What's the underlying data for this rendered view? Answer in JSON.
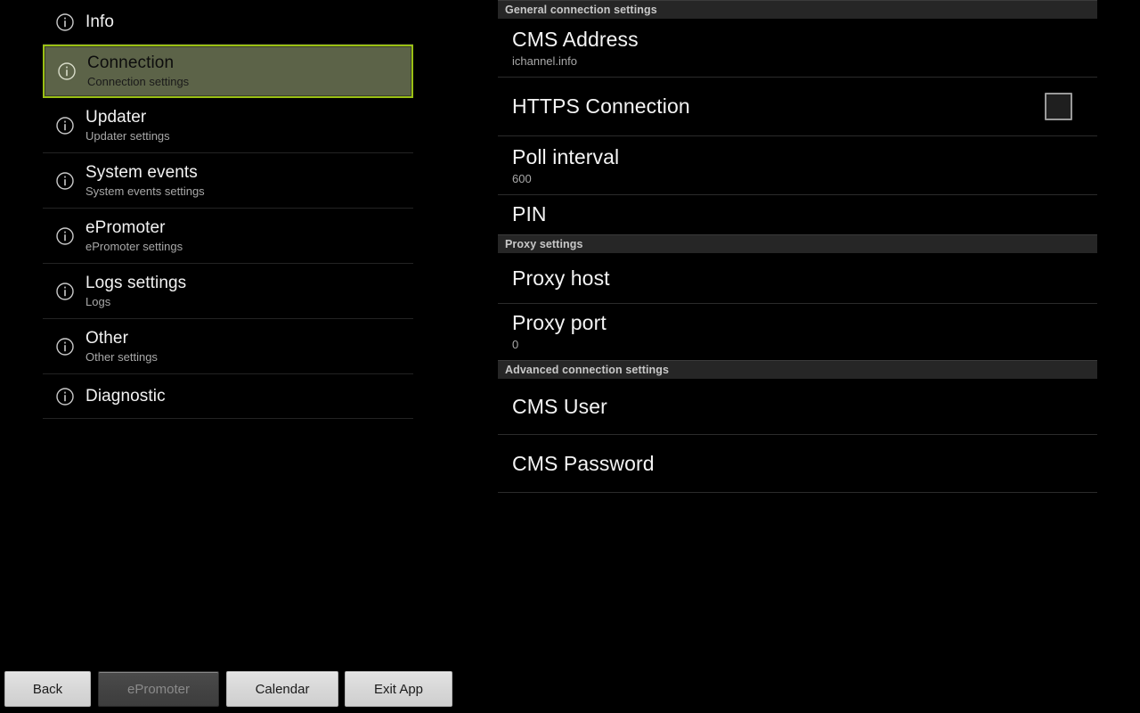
{
  "colors": {
    "background": "#000000",
    "selected_fill": "#5c6348",
    "selected_border": "#9ac014",
    "section_header_bg": "#262626",
    "divider": "#2b2b2b",
    "title_text": "#f2f2f2",
    "subtitle_text": "#a8a8a8"
  },
  "sidebar": {
    "items": [
      {
        "title": "Info",
        "subtitle": "",
        "icon": "info-icon",
        "selected": false
      },
      {
        "title": "Connection",
        "subtitle": "Connection settings",
        "icon": "info-icon",
        "selected": true
      },
      {
        "title": "Updater",
        "subtitle": "Updater settings",
        "icon": "info-icon",
        "selected": false
      },
      {
        "title": "System events",
        "subtitle": "System events settings",
        "icon": "info-icon",
        "selected": false
      },
      {
        "title": "ePromoter",
        "subtitle": "ePromoter settings",
        "icon": "info-icon",
        "selected": false
      },
      {
        "title": "Logs settings",
        "subtitle": "Logs",
        "icon": "info-icon",
        "selected": false
      },
      {
        "title": "Other",
        "subtitle": "Other settings",
        "icon": "info-icon",
        "selected": false
      },
      {
        "title": "Diagnostic",
        "subtitle": "",
        "icon": "info-icon",
        "selected": false
      }
    ]
  },
  "panel": {
    "sections": [
      {
        "header": "General connection settings",
        "rows": [
          {
            "title": "CMS Address",
            "value": "ichannel.info",
            "widget": "none"
          },
          {
            "title": "HTTPS Connection",
            "value": "",
            "widget": "checkbox",
            "checked": false
          },
          {
            "title": "Poll interval",
            "value": "600",
            "widget": "none"
          },
          {
            "title": "PIN",
            "value": "",
            "widget": "none"
          }
        ]
      },
      {
        "header": "Proxy settings",
        "rows": [
          {
            "title": "Proxy host",
            "value": "",
            "widget": "none"
          },
          {
            "title": "Proxy port",
            "value": "0",
            "widget": "none"
          }
        ]
      },
      {
        "header": "Advanced connection settings",
        "rows": [
          {
            "title": "CMS User",
            "value": "",
            "widget": "none"
          },
          {
            "title": "CMS Password",
            "value": "",
            "widget": "none"
          }
        ]
      }
    ]
  },
  "buttonbar": {
    "back_label": "Back",
    "epromoter_label": "ePromoter",
    "epromoter_disabled": true,
    "calendar_label": "Calendar",
    "exit_label": "Exit App"
  }
}
